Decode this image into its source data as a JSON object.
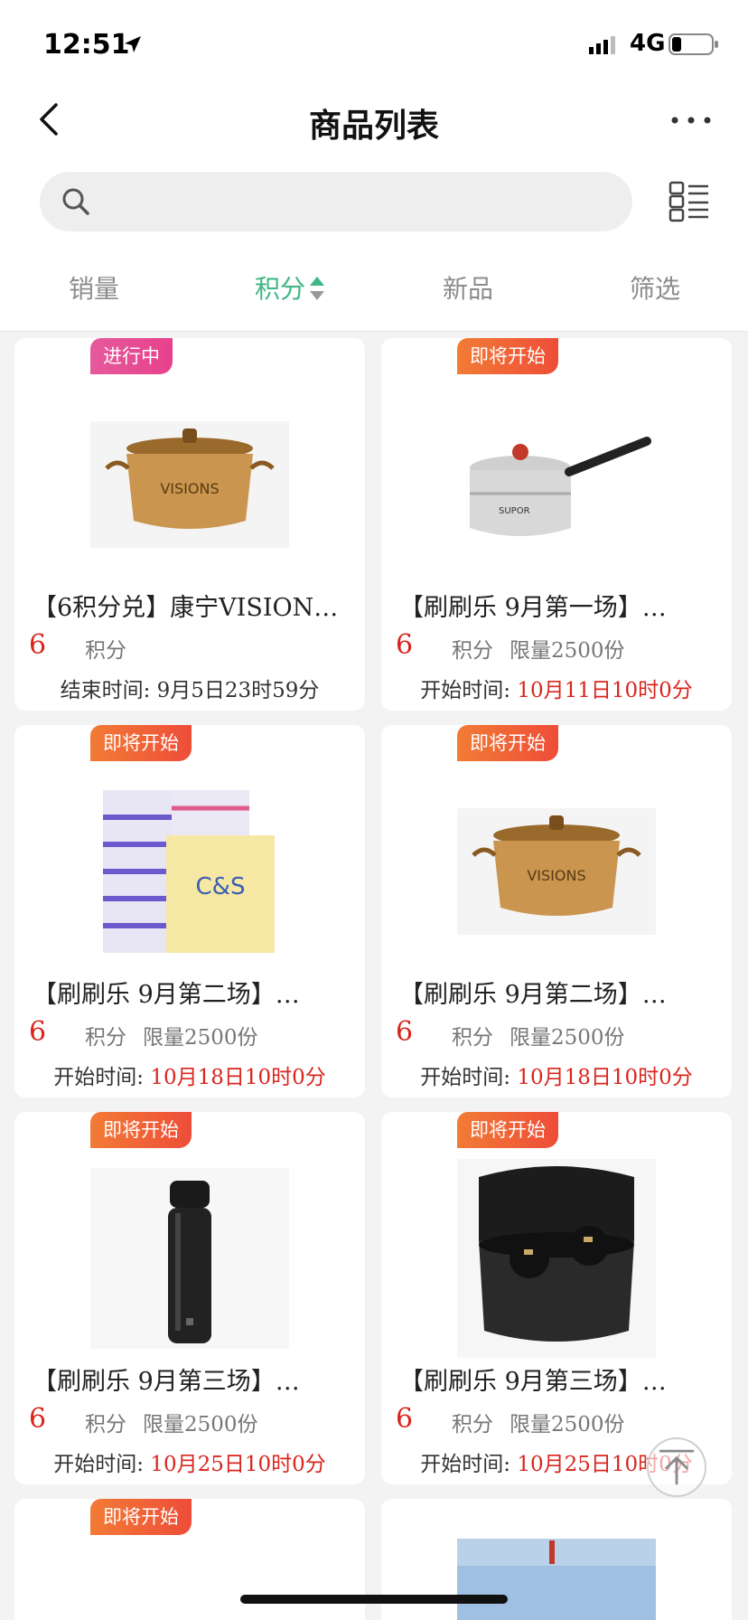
{
  "status_bar": {
    "time": "12:51",
    "network": "4G"
  },
  "nav": {
    "title": "商品列表"
  },
  "search": {
    "placeholder": ""
  },
  "sort_tabs": [
    {
      "label": "销量",
      "active": false
    },
    {
      "label": "积分",
      "active": true
    },
    {
      "label": "新品",
      "active": false
    },
    {
      "label": "筛选",
      "active": false
    }
  ],
  "colors": {
    "accent": "#3fb685",
    "price": "#d8261e",
    "badge_ongoing": "#e8418d",
    "badge_upcoming": "#ee4d38"
  },
  "products": [
    {
      "badge": "进行中",
      "badge_type": "ongoing",
      "image": "visions-pot-icon",
      "title": "【6积分兑】康宁VISIONS…",
      "points": "6",
      "points_unit": "积分",
      "limit": "",
      "time_label": "结束时间: ",
      "time_value": "9月5日23时59分",
      "time_value_red": false
    },
    {
      "badge": "即将开始",
      "badge_type": "upcoming",
      "image": "supor-saucepan-icon",
      "title": "【刷刷乐 9月第一场】…",
      "points": "6",
      "points_unit": "积分",
      "limit": "限量2500份",
      "time_label": "开始时间: ",
      "time_value": "10月11日10时0分",
      "time_value_red": true
    },
    {
      "badge": "即将开始",
      "badge_type": "upcoming",
      "image": "tissue-pack-icon",
      "title": "【刷刷乐 9月第二场】…",
      "points": "6",
      "points_unit": "积分",
      "limit": "限量2500份",
      "time_label": "开始时间: ",
      "time_value": "10月18日10时0分",
      "time_value_red": true
    },
    {
      "badge": "即将开始",
      "badge_type": "upcoming",
      "image": "visions-pot-icon",
      "title": "【刷刷乐 9月第二场】…",
      "points": "6",
      "points_unit": "积分",
      "limit": "限量2500份",
      "time_label": "开始时间: ",
      "time_value": "10月18日10时0分",
      "time_value_red": true
    },
    {
      "badge": "即将开始",
      "badge_type": "upcoming",
      "image": "thermos-bottle-icon",
      "title": "【刷刷乐 9月第三场】…",
      "points": "6",
      "points_unit": "积分",
      "limit": "限量2500份",
      "time_label": "开始时间: ",
      "time_value": "10月25日10时0分",
      "time_value_red": true
    },
    {
      "badge": "即将开始",
      "badge_type": "upcoming",
      "image": "earbuds-case-icon",
      "title": "【刷刷乐 9月第三场】…",
      "points": "6",
      "points_unit": "积分",
      "limit": "限量2500份",
      "time_label": "开始时间: ",
      "time_value": "10月25日10时0分",
      "time_value_red": true
    },
    {
      "badge": "即将开始",
      "badge_type": "upcoming",
      "image": "",
      "title": "",
      "points": "",
      "points_unit": "",
      "limit": "",
      "time_label": "",
      "time_value": "",
      "time_value_red": false
    },
    {
      "badge": "",
      "badge_type": "",
      "image": "product-photo-icon",
      "title": "",
      "points": "",
      "points_unit": "",
      "limit": "",
      "time_label": "",
      "time_value": "",
      "time_value_red": false
    }
  ]
}
